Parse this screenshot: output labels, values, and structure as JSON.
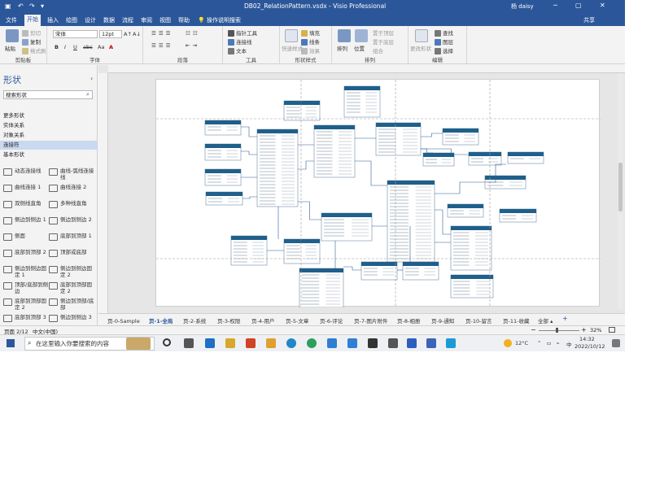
{
  "titlebar": {
    "file_name": "DB02_RelationPattern.vsdx",
    "separator": " - ",
    "app_name": "Visio Professional",
    "user_name": "杨 daisy",
    "minimize": "─",
    "restore": "▢",
    "close": "✕",
    "save_glyph": "▣",
    "undo_glyph": "↶",
    "redo_glyph": "↷",
    "customize_glyph": "▾"
  },
  "tabs": [
    "文件",
    "开始",
    "插入",
    "绘图",
    "设计",
    "数据",
    "流程",
    "审阅",
    "视图",
    "帮助"
  ],
  "active_tab": "开始",
  "tell_me": "操作说明搜索",
  "share": "共享",
  "ribbon": {
    "clipboard": {
      "paste": "粘贴",
      "cut": "剪切",
      "copy": "复制",
      "format_painter": "格式刷",
      "label": "剪贴板"
    },
    "font": {
      "font_name": "宋体",
      "font_size": "12pt",
      "bold": "B",
      "italic": "I",
      "underline": "U",
      "strike": "abc",
      "case": "Aa",
      "color": "A",
      "grow": "A↑",
      "shrink": "A↓",
      "label": "字体"
    },
    "paragraph": {
      "label": "段落"
    },
    "tools": {
      "pointer": "指针工具",
      "connector": "连接线",
      "text": "文本",
      "label": "工具"
    },
    "shape_styles": {
      "fill": "填充",
      "line": "线条",
      "effects": "效果",
      "quick_styles": "快速样式",
      "label": "形状样式"
    },
    "arrange": {
      "arrange": "排列",
      "position": "位置",
      "bring_front": "置于顶层",
      "send_back": "置于底层",
      "group": "组合",
      "label": "排列"
    },
    "editing": {
      "find": "查找",
      "layers": "图层",
      "select": "选择",
      "change_shape": "更改形状",
      "label": "编辑"
    }
  },
  "shapes_panel": {
    "title": "形状",
    "collapse_glyph": "‹",
    "search_placeholder": "搜索形状",
    "categories": [
      "更多形状",
      "实体关系",
      "对象关系",
      "连接符",
      "基本形状"
    ],
    "selected_category": "连接符",
    "stencils": [
      [
        "动态连接线",
        "曲线-弧线连接线"
      ],
      [
        "曲线连接 1",
        "曲线连接 2"
      ],
      [
        "双侧线直角",
        "多种线直角"
      ],
      [
        "侧边到侧边 1",
        "侧边到侧边 2"
      ],
      [
        "侧面",
        "底部到顶部 1"
      ],
      [
        "底部到顶部 2",
        "顶部或底部"
      ],
      [
        "侧边到侧边固定 1",
        "侧边到侧边固定 2"
      ],
      [
        "顶部/底部到侧边",
        "底部到顶部固定 2"
      ],
      [
        "底部到顶部固定 2",
        "侧边到顶部/底部"
      ],
      [
        "底部到顶部 3",
        "侧边到侧边 3"
      ]
    ]
  },
  "pages": [
    "页-0-Sample",
    "页-1-全局",
    "页-2-系统",
    "页-3-权限",
    "页-4-用户",
    "页-5-文章",
    "页-6-评论",
    "页-7-图片附件",
    "页-8-相册",
    "页-9-通知",
    "页-10-留言",
    "页-11-收藏"
  ],
  "active_page": "页-1-全局",
  "pages_all": "全部",
  "pages_add_glyph": "+",
  "status": {
    "page": "页面 2/12",
    "language": "中文(中国)",
    "zoom": "32%",
    "zoom_minus": "−",
    "zoom_plus": "+"
  },
  "taskbar": {
    "search_placeholder": "在这里输入你要搜索的内容",
    "temperature": "12°C",
    "time": "14:32",
    "date": "2022/10/12",
    "ime": "中"
  },
  "colors": {
    "accent": "#2b579a",
    "entity_header": "#1f5f8b"
  }
}
